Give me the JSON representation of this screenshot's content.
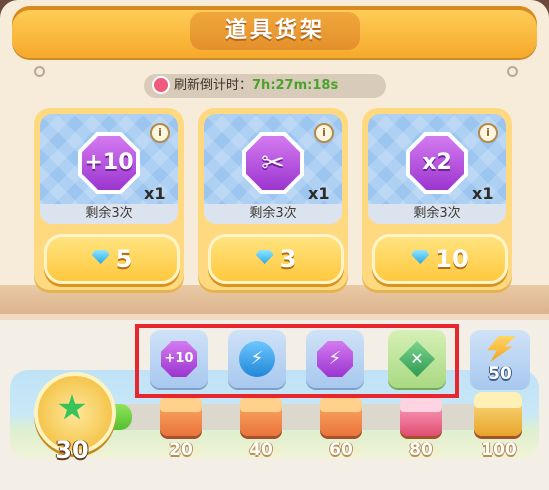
{
  "shop": {
    "title": "道具货架",
    "timer_label": "刷新倒计时：",
    "timer_value": "7h:27m:18s"
  },
  "items": [
    {
      "icon": "plus-ten-booster-icon",
      "icon_text": "+10",
      "quantity": "x1",
      "remaining": "剩余3次",
      "price": "5",
      "color": "#b04ee0"
    },
    {
      "icon": "scissors-booster-icon",
      "icon_text": "✂",
      "quantity": "x1",
      "remaining": "剩余3次",
      "price": "3",
      "color": "#b04ee0"
    },
    {
      "icon": "times-two-booster-icon",
      "icon_text": "x2",
      "quantity": "x1",
      "remaining": "剩余3次",
      "price": "10",
      "color": "#b04ee0"
    }
  ],
  "toolbar": [
    {
      "icon": "plus-ten-tool-icon",
      "text": "+10",
      "color": "#b04ee0",
      "green": false
    },
    {
      "icon": "lightning-tool-icon",
      "text": "⚡",
      "color": "#3ba3e8",
      "green": false
    },
    {
      "icon": "lightning-purple-tool-icon",
      "text": "⚡",
      "color": "#b04ee0",
      "green": false
    },
    {
      "icon": "cross-tool-icon",
      "text": "✕",
      "color": "#39a85a",
      "green": true
    }
  ],
  "energy": {
    "icon": "energy-bolt-icon",
    "amount": "50"
  },
  "progress": {
    "level": "30",
    "fraction": 0.06,
    "milestones": [
      "20",
      "40",
      "60",
      "80",
      "100"
    ],
    "milestone_icons": [
      "chest-icon",
      "chest-icon",
      "chest-icon",
      "heart-chest-icon",
      "treasure-chest-icon"
    ]
  },
  "colors": {
    "accent": "#f6a92a",
    "highlight": "#e8262e",
    "timer_text": "#4aa42b"
  }
}
